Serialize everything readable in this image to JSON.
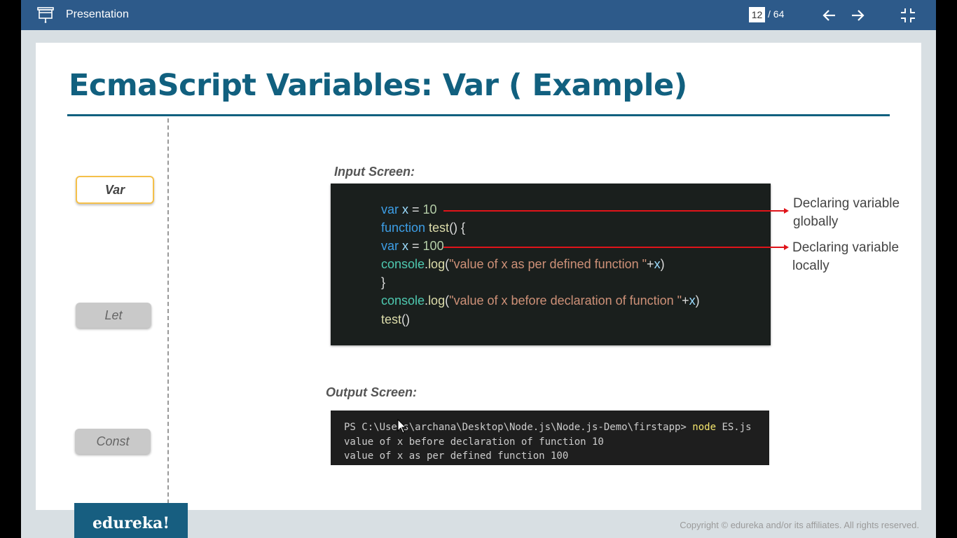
{
  "toolbar": {
    "title": "Presentation",
    "current_page": "12",
    "total_pages": "/ 64",
    "icons": [
      "presentation-icon",
      "arrow-left-icon",
      "arrow-right-icon",
      "collapse-icon"
    ]
  },
  "slide": {
    "title": "EcmaScript Variables: Var ( Example)",
    "sidebar": {
      "var_label": "Var",
      "let_label": "Let",
      "const_label": "Const"
    },
    "input_label": "Input Screen:",
    "output_label": "Output Screen:",
    "code": {
      "l1_kw": "var",
      "l1_var": " x",
      "l1_eq": " = ",
      "l1_num": "10",
      "l2_kw": "function",
      "l2_fn": " test",
      "l2_rest": "() {",
      "l3_kw": "var",
      "l3_var": " x",
      "l3_eq": " = ",
      "l3_num": "100",
      "l4_obj": "console",
      "l4_dot": ".",
      "l4_fn": "log",
      "l4_paren": "(",
      "l4_str": "\"value of x as per defined function \"",
      "l4_plus": "+",
      "l4_var": "x",
      "l4_close": ")",
      "l5": "}",
      "l6_obj": "console",
      "l6_dot": ".",
      "l6_fn": "log",
      "l6_paren": "(",
      "l6_str": "\"value of x before declaration of function \"",
      "l6_plus": "+",
      "l6_var": "x",
      "l6_close": ")",
      "l7_fn": "test",
      "l7_rest": "()"
    },
    "annotations": {
      "global_1": "Declaring variable",
      "global_2": "globally",
      "local_1": "Declaring variable",
      "local_2": "locally"
    },
    "terminal": {
      "line1_prefix": "PS C:\\Users\\archana\\Desktop\\Node.js\\Node.js-Demo\\firstapp> ",
      "line1_cmd": "node",
      "line1_arg": " ES.js",
      "line2": "value of x before declaration of function 10",
      "line3": "value of x as per defined function 100"
    },
    "brand": "edureka!",
    "copyright": "Copyright © edureka and/or its affiliates. All rights reserved."
  },
  "colors": {
    "toolbar_bg": "#2d5a8a",
    "title_color": "#11607f",
    "arrow_red": "#e0141a",
    "active_border": "#f5c04a",
    "code_bg": "#1a1f1d"
  }
}
